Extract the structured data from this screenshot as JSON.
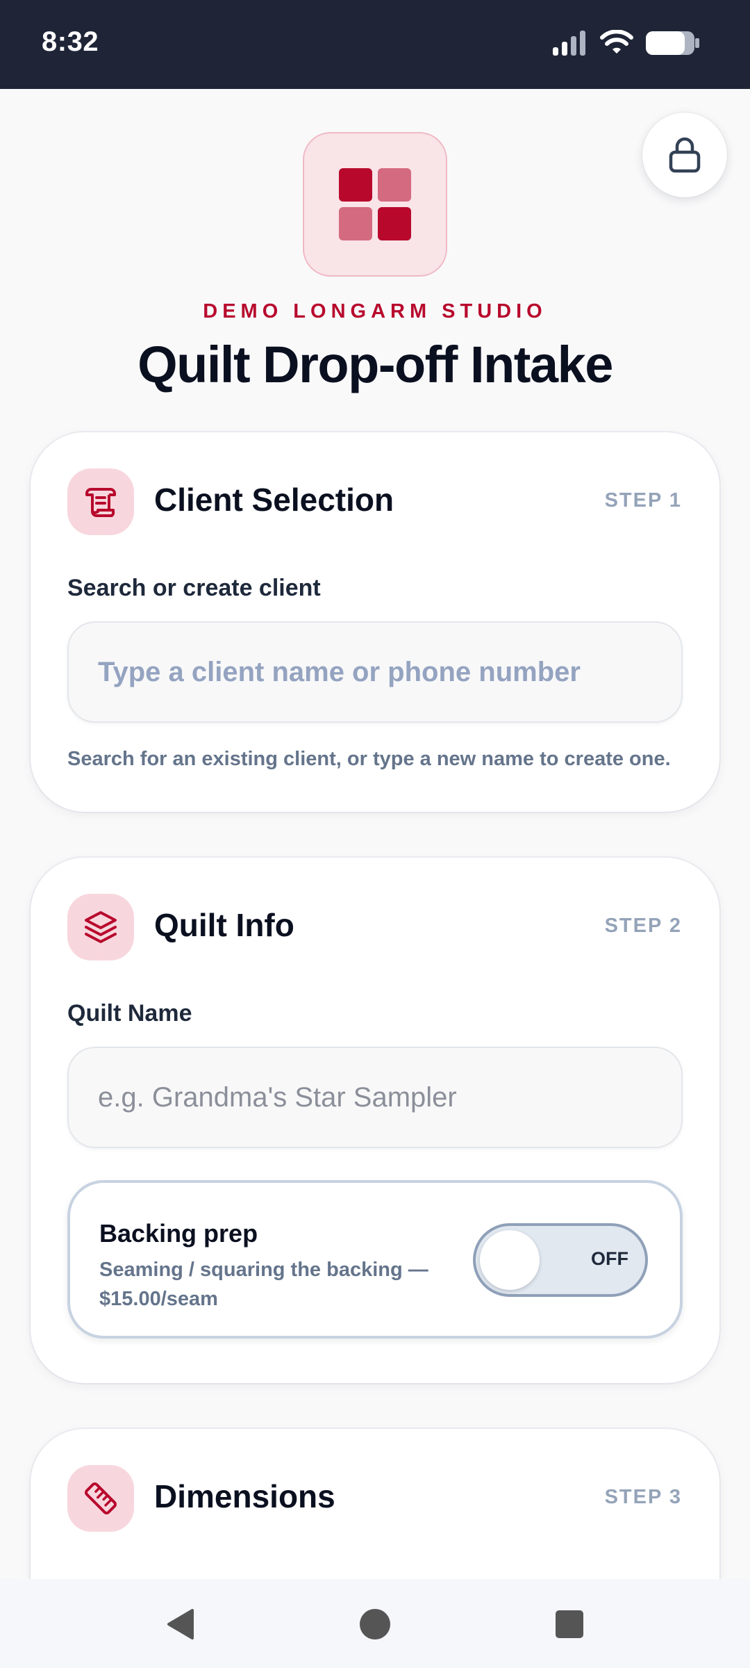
{
  "status_bar": {
    "time": "8:32"
  },
  "header": {
    "studio_name": "DEMO LONGARM STUDIO",
    "title": "Quilt Drop-off Intake",
    "logo_icon": "quilt-blocks-icon",
    "lock_icon": "lock-icon"
  },
  "client_card": {
    "icon": "scroll-icon",
    "title": "Client Selection",
    "step": "STEP 1",
    "field_label": "Search or create client",
    "placeholder": "Type a client name or phone number",
    "helper": "Search for an existing client, or type a new name to create one."
  },
  "quilt_card": {
    "icon": "layers-icon",
    "title": "Quilt Info",
    "step": "STEP 2",
    "field_label": "Quilt Name",
    "placeholder": "e.g. Grandma's Star Sampler",
    "backing": {
      "title": "Backing prep",
      "description": "Seaming / squaring the backing — $15.00/seam",
      "toggle_label": "OFF",
      "enabled": false
    }
  },
  "dimensions_card": {
    "icon": "ruler-icon",
    "title": "Dimensions",
    "step": "STEP 3"
  },
  "colors": {
    "accent": "#b8092d",
    "status_bar": "#1f2537"
  }
}
